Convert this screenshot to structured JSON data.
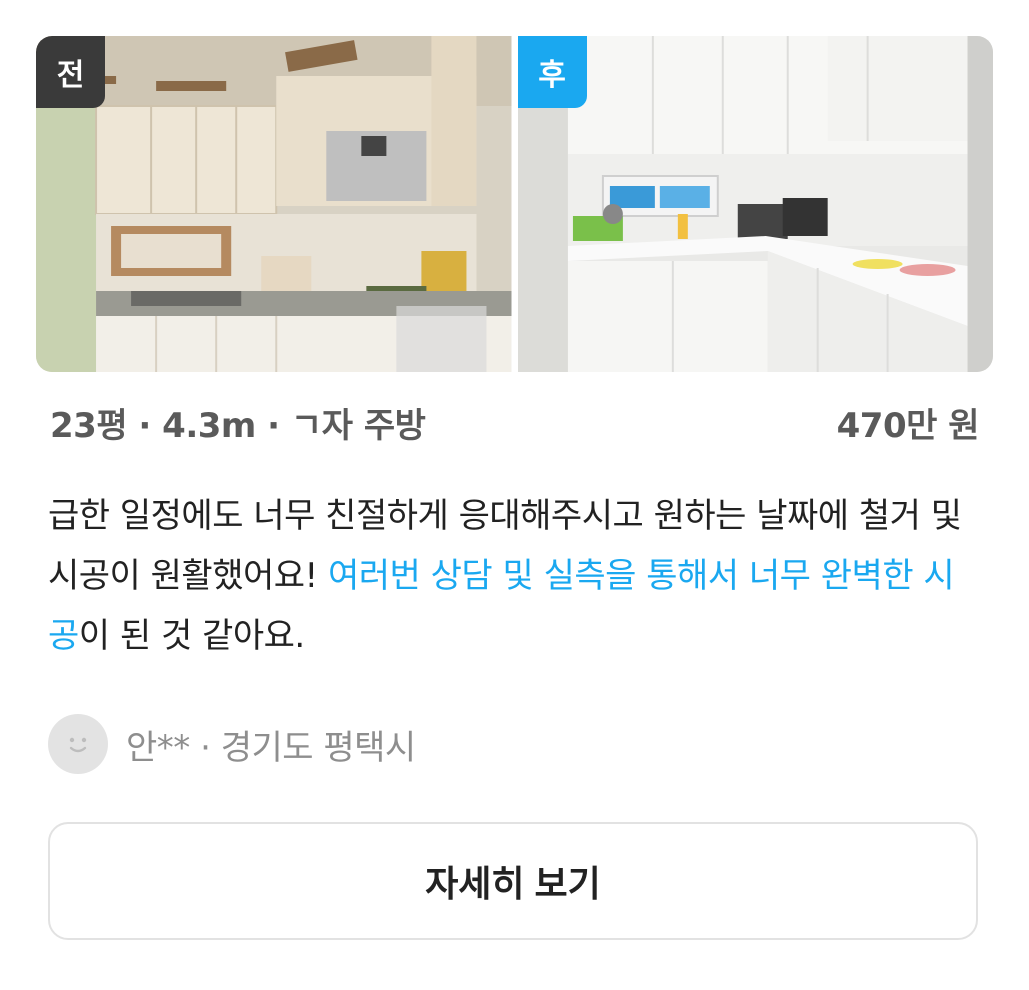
{
  "photos": {
    "before": {
      "badge": "전"
    },
    "after": {
      "badge": "후"
    }
  },
  "listing": {
    "spec": "23평 · 4.3m · ㄱ자 주방",
    "price": "470만 원"
  },
  "review": {
    "text_part1": "급한 일정에도 너무 친절하게 응대해주시고 원하는 날짜에 철거 및 시공이 원활했어요! ",
    "highlight": "여러번 상담 및 실측을 통해서 너무 완벽한 시공",
    "text_part2": "이 된 것 같아요."
  },
  "author": {
    "name": "안**",
    "separator": " · ",
    "location": "경기도 평택시",
    "avatar_icon": "smiley-face-icon"
  },
  "actions": {
    "detail_label": "자세히 보기"
  },
  "colors": {
    "accent": "#1aa8f0",
    "before_badge": "#3a3a3a",
    "after_badge": "#1aa8f0"
  }
}
